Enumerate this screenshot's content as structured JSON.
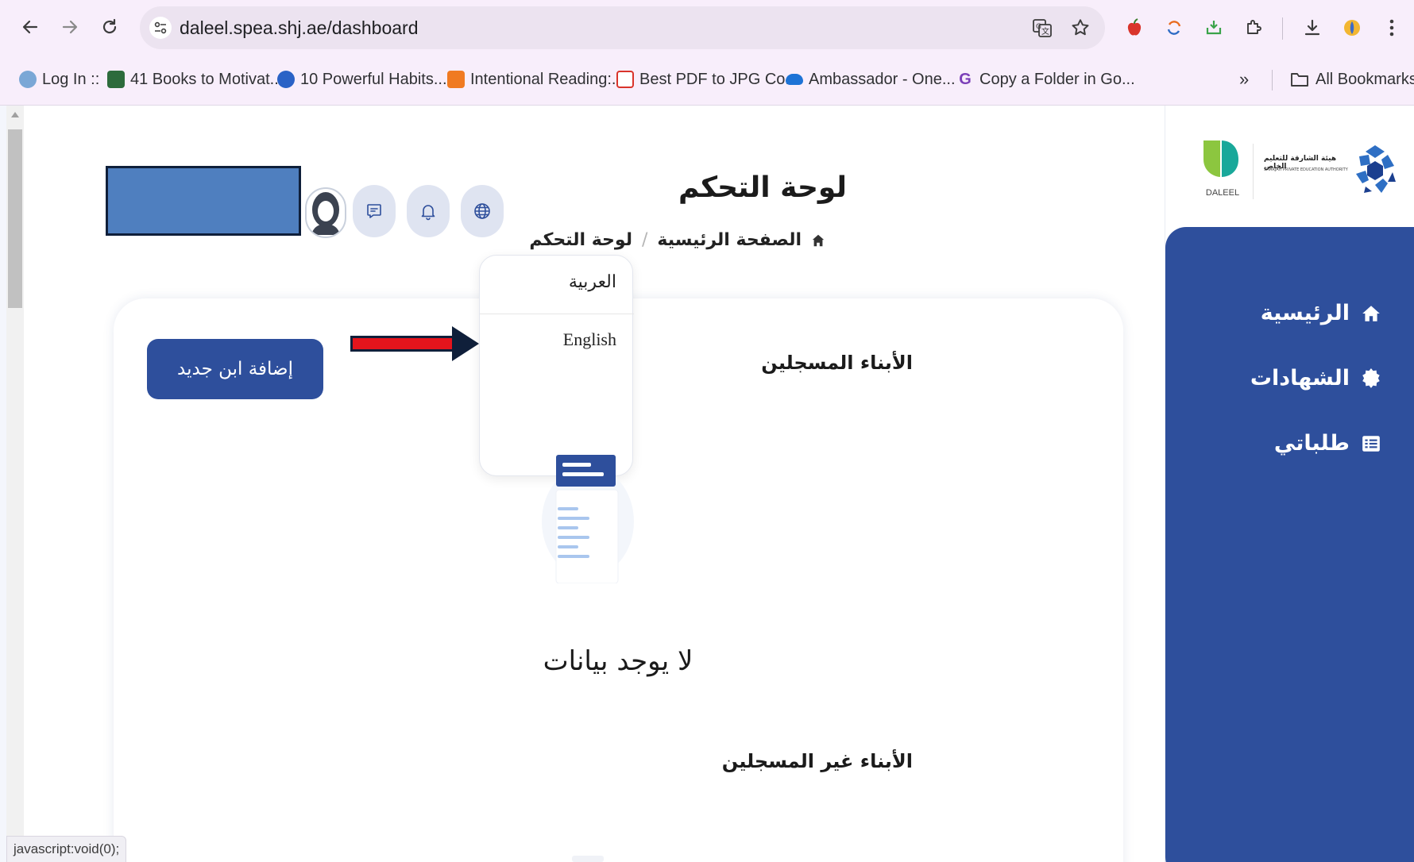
{
  "browser": {
    "url": "daleel.spea.shj.ae/dashboard",
    "bookmarks": [
      {
        "label": "Log In ::",
        "icon": "gear-favicon",
        "color": "#7aa7d6"
      },
      {
        "label": "41 Books to Motivat...",
        "icon": "s-favicon",
        "color": "#2d6b3c"
      },
      {
        "label": "10 Powerful Habits...",
        "icon": "spiral-favicon",
        "color": "#2a62c6"
      },
      {
        "label": "Intentional Reading:...",
        "icon": "reading-favicon",
        "color": "#f07a22"
      },
      {
        "label": "Best PDF to JPG Co...",
        "icon": "pdf-favicon",
        "color": "#d9342b"
      },
      {
        "label": "Ambassador - One...",
        "icon": "cloud-favicon",
        "color": "#1d73d6"
      },
      {
        "label": "Copy a Folder in Go...",
        "icon": "g-favicon",
        "color": "#7b3fb8"
      }
    ],
    "more_bookmarks": "»",
    "all_bookmarks": "All Bookmarks",
    "status_tip": "javascript:void(0);"
  },
  "header": {
    "title": "لوحة التحكم",
    "breadcrumb": {
      "home": "الصفحة الرئيسية",
      "separator": "/",
      "current": "لوحة التحكم"
    }
  },
  "sidebar": {
    "logo_caption": "DALEEL",
    "authority_ar": "هيئة الشارقة للتعليم الخاص",
    "authority_en": "SHARJAH PRIVATE EDUCATION AUTHORITY",
    "items": [
      {
        "label": "الرئيسية",
        "icon": "home-icon"
      },
      {
        "label": "الشهادات",
        "icon": "badge-icon"
      },
      {
        "label": "طلباتي",
        "icon": "list-icon"
      }
    ]
  },
  "language_menu": {
    "options": [
      "العربية",
      "English"
    ]
  },
  "main": {
    "registered_title": "الأبناء المسجلين",
    "add_child_button": "إضافة ابن جديد",
    "empty_state": "لا يوجد بيانات",
    "unregistered_title": "الأبناء غير المسجلين"
  },
  "colors": {
    "primary": "#2e4f9c",
    "annotation_arrow": "#e4141c"
  }
}
